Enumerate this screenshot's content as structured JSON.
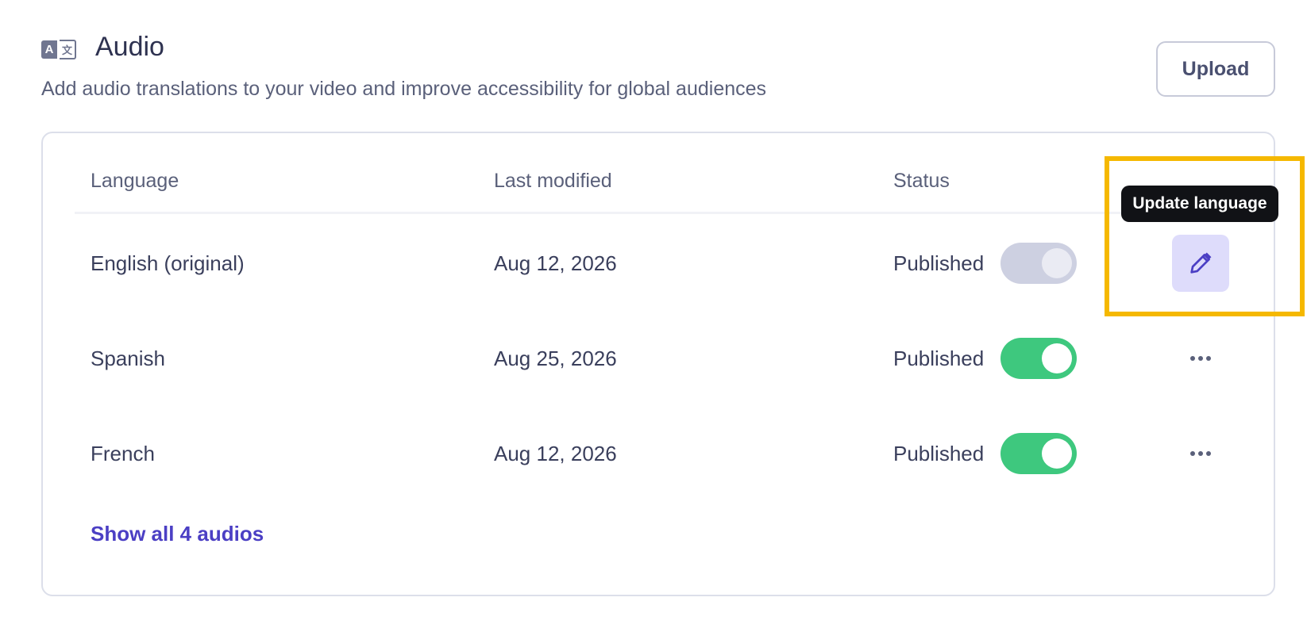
{
  "header": {
    "icon": "translate-icon",
    "icon_glyphs": [
      "A",
      "文"
    ],
    "title": "Audio",
    "subtitle": "Add audio translations to your video and improve accessibility for global audiences",
    "upload_label": "Upload"
  },
  "table": {
    "columns": [
      "Language",
      "Last modified",
      "Status"
    ],
    "rows": [
      {
        "language": "English (original)",
        "modified": "Aug 12, 2026",
        "status": "Published",
        "toggle_on": true,
        "toggle_enabled": false,
        "action": "edit-icon"
      },
      {
        "language": "Spanish",
        "modified": "Aug 25, 2026",
        "status": "Published",
        "toggle_on": true,
        "toggle_enabled": true,
        "action": "more-icon"
      },
      {
        "language": "French",
        "modified": "Aug 12, 2026",
        "status": "Published",
        "toggle_on": true,
        "toggle_enabled": true,
        "action": "more-icon"
      }
    ],
    "tooltip": "Update language",
    "show_all_label": "Show all 4 audios"
  },
  "colors": {
    "accent": "#4b3fc4",
    "toggle_on": "#3ec87e",
    "toggle_disabled": "#cdd0e1",
    "highlight": "#f5b800",
    "tooltip_bg": "#111216"
  }
}
